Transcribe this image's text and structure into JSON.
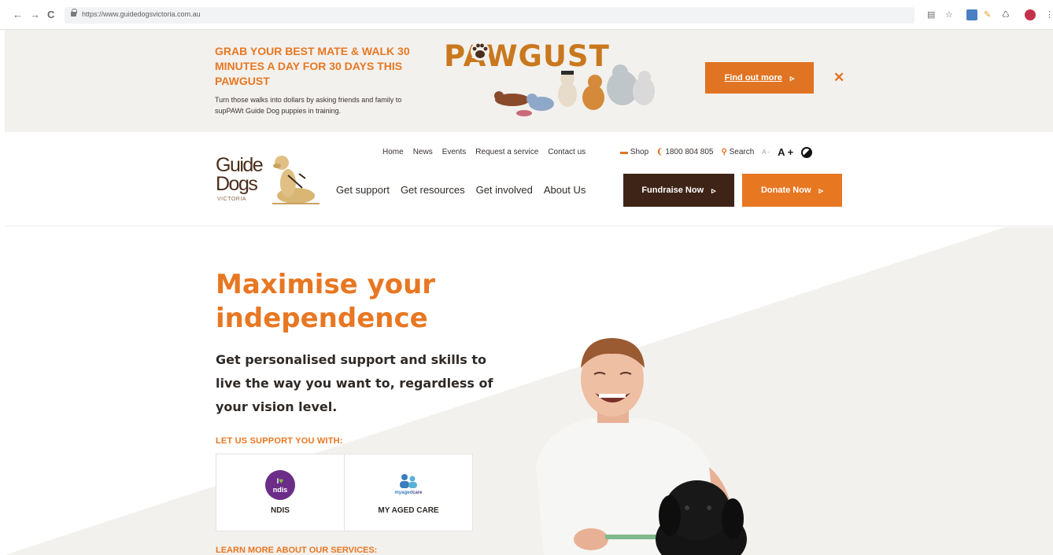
{
  "browser": {
    "url": "https://www.guidedogsvictoria.com.au",
    "back_icon": "←",
    "forward_icon": "→",
    "reload_icon": "C"
  },
  "promo": {
    "heading": "GRAB YOUR BEST MATE & WALK 30 MINUTES A DAY FOR 30 DAYS THIS PAWGUST",
    "text": "Turn those walks into dollars by asking friends and family to supPAWt Guide Dog puppies in training.",
    "logo_text": "PAWGUST",
    "cta_label": "Find out more",
    "close_label": "✕"
  },
  "header": {
    "logo_line1": "Guide",
    "logo_line2": "Dogs",
    "logo_sub": "VICTORIA",
    "utility_links": [
      "Home",
      "News",
      "Events",
      "Request a service",
      "Contact us"
    ],
    "shop_label": "Shop",
    "phone_label": "1800 804 805",
    "search_label": "Search",
    "font_decrease": "A -",
    "font_increase": "A +",
    "main_nav": [
      "Get support",
      "Get resources",
      "Get involved",
      "About Us"
    ],
    "fundraise_label": "Fundraise Now",
    "donate_label": "Donate Now"
  },
  "hero": {
    "title": "Maximise your independence",
    "subtitle": "Get personalised support and skills to live the way you want to, regardless of your vision level.",
    "support_label": "LET US SUPPORT YOU WITH:",
    "cards": [
      {
        "label": "NDIS",
        "badge_line1": "I",
        "badge_line2": "ndis"
      },
      {
        "label": "MY AGED CARE",
        "logo_text_a": "my",
        "logo_text_b": "aged",
        "logo_text_c": "care"
      }
    ],
    "learn_label": "LEARN MORE ABOUT OUR SERVICES:"
  },
  "colors": {
    "accent": "#e87722",
    "brown": "#3e2417",
    "banner_bg": "#f3f1ee"
  }
}
